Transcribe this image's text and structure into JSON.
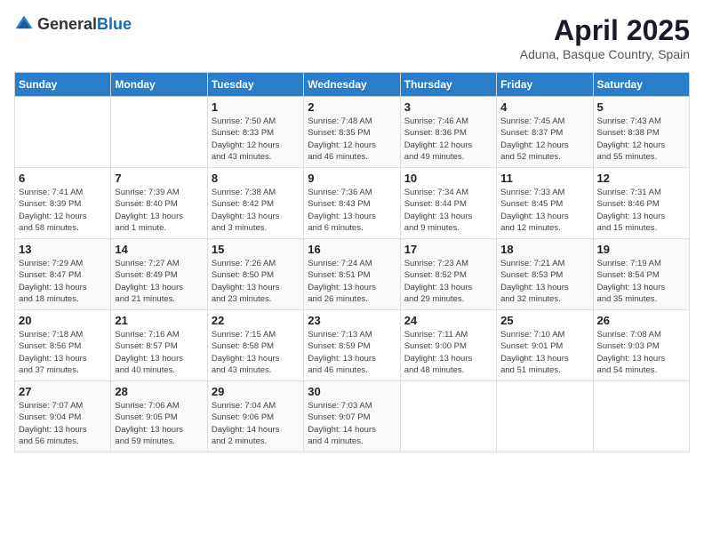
{
  "logo": {
    "general": "General",
    "blue": "Blue"
  },
  "title": "April 2025",
  "subtitle": "Aduna, Basque Country, Spain",
  "days_of_week": [
    "Sunday",
    "Monday",
    "Tuesday",
    "Wednesday",
    "Thursday",
    "Friday",
    "Saturday"
  ],
  "weeks": [
    [
      {
        "day": "",
        "lines": []
      },
      {
        "day": "",
        "lines": []
      },
      {
        "day": "1",
        "lines": [
          "Sunrise: 7:50 AM",
          "Sunset: 8:33 PM",
          "Daylight: 12 hours",
          "and 43 minutes."
        ]
      },
      {
        "day": "2",
        "lines": [
          "Sunrise: 7:48 AM",
          "Sunset: 8:35 PM",
          "Daylight: 12 hours",
          "and 46 minutes."
        ]
      },
      {
        "day": "3",
        "lines": [
          "Sunrise: 7:46 AM",
          "Sunset: 8:36 PM",
          "Daylight: 12 hours",
          "and 49 minutes."
        ]
      },
      {
        "day": "4",
        "lines": [
          "Sunrise: 7:45 AM",
          "Sunset: 8:37 PM",
          "Daylight: 12 hours",
          "and 52 minutes."
        ]
      },
      {
        "day": "5",
        "lines": [
          "Sunrise: 7:43 AM",
          "Sunset: 8:38 PM",
          "Daylight: 12 hours",
          "and 55 minutes."
        ]
      }
    ],
    [
      {
        "day": "6",
        "lines": [
          "Sunrise: 7:41 AM",
          "Sunset: 8:39 PM",
          "Daylight: 12 hours",
          "and 58 minutes."
        ]
      },
      {
        "day": "7",
        "lines": [
          "Sunrise: 7:39 AM",
          "Sunset: 8:40 PM",
          "Daylight: 13 hours",
          "and 1 minute."
        ]
      },
      {
        "day": "8",
        "lines": [
          "Sunrise: 7:38 AM",
          "Sunset: 8:42 PM",
          "Daylight: 13 hours",
          "and 3 minutes."
        ]
      },
      {
        "day": "9",
        "lines": [
          "Sunrise: 7:36 AM",
          "Sunset: 8:43 PM",
          "Daylight: 13 hours",
          "and 6 minutes."
        ]
      },
      {
        "day": "10",
        "lines": [
          "Sunrise: 7:34 AM",
          "Sunset: 8:44 PM",
          "Daylight: 13 hours",
          "and 9 minutes."
        ]
      },
      {
        "day": "11",
        "lines": [
          "Sunrise: 7:33 AM",
          "Sunset: 8:45 PM",
          "Daylight: 13 hours",
          "and 12 minutes."
        ]
      },
      {
        "day": "12",
        "lines": [
          "Sunrise: 7:31 AM",
          "Sunset: 8:46 PM",
          "Daylight: 13 hours",
          "and 15 minutes."
        ]
      }
    ],
    [
      {
        "day": "13",
        "lines": [
          "Sunrise: 7:29 AM",
          "Sunset: 8:47 PM",
          "Daylight: 13 hours",
          "and 18 minutes."
        ]
      },
      {
        "day": "14",
        "lines": [
          "Sunrise: 7:27 AM",
          "Sunset: 8:49 PM",
          "Daylight: 13 hours",
          "and 21 minutes."
        ]
      },
      {
        "day": "15",
        "lines": [
          "Sunrise: 7:26 AM",
          "Sunset: 8:50 PM",
          "Daylight: 13 hours",
          "and 23 minutes."
        ]
      },
      {
        "day": "16",
        "lines": [
          "Sunrise: 7:24 AM",
          "Sunset: 8:51 PM",
          "Daylight: 13 hours",
          "and 26 minutes."
        ]
      },
      {
        "day": "17",
        "lines": [
          "Sunrise: 7:23 AM",
          "Sunset: 8:52 PM",
          "Daylight: 13 hours",
          "and 29 minutes."
        ]
      },
      {
        "day": "18",
        "lines": [
          "Sunrise: 7:21 AM",
          "Sunset: 8:53 PM",
          "Daylight: 13 hours",
          "and 32 minutes."
        ]
      },
      {
        "day": "19",
        "lines": [
          "Sunrise: 7:19 AM",
          "Sunset: 8:54 PM",
          "Daylight: 13 hours",
          "and 35 minutes."
        ]
      }
    ],
    [
      {
        "day": "20",
        "lines": [
          "Sunrise: 7:18 AM",
          "Sunset: 8:56 PM",
          "Daylight: 13 hours",
          "and 37 minutes."
        ]
      },
      {
        "day": "21",
        "lines": [
          "Sunrise: 7:16 AM",
          "Sunset: 8:57 PM",
          "Daylight: 13 hours",
          "and 40 minutes."
        ]
      },
      {
        "day": "22",
        "lines": [
          "Sunrise: 7:15 AM",
          "Sunset: 8:58 PM",
          "Daylight: 13 hours",
          "and 43 minutes."
        ]
      },
      {
        "day": "23",
        "lines": [
          "Sunrise: 7:13 AM",
          "Sunset: 8:59 PM",
          "Daylight: 13 hours",
          "and 46 minutes."
        ]
      },
      {
        "day": "24",
        "lines": [
          "Sunrise: 7:11 AM",
          "Sunset: 9:00 PM",
          "Daylight: 13 hours",
          "and 48 minutes."
        ]
      },
      {
        "day": "25",
        "lines": [
          "Sunrise: 7:10 AM",
          "Sunset: 9:01 PM",
          "Daylight: 13 hours",
          "and 51 minutes."
        ]
      },
      {
        "day": "26",
        "lines": [
          "Sunrise: 7:08 AM",
          "Sunset: 9:03 PM",
          "Daylight: 13 hours",
          "and 54 minutes."
        ]
      }
    ],
    [
      {
        "day": "27",
        "lines": [
          "Sunrise: 7:07 AM",
          "Sunset: 9:04 PM",
          "Daylight: 13 hours",
          "and 56 minutes."
        ]
      },
      {
        "day": "28",
        "lines": [
          "Sunrise: 7:06 AM",
          "Sunset: 9:05 PM",
          "Daylight: 13 hours",
          "and 59 minutes."
        ]
      },
      {
        "day": "29",
        "lines": [
          "Sunrise: 7:04 AM",
          "Sunset: 9:06 PM",
          "Daylight: 14 hours",
          "and 2 minutes."
        ]
      },
      {
        "day": "30",
        "lines": [
          "Sunrise: 7:03 AM",
          "Sunset: 9:07 PM",
          "Daylight: 14 hours",
          "and 4 minutes."
        ]
      },
      {
        "day": "",
        "lines": []
      },
      {
        "day": "",
        "lines": []
      },
      {
        "day": "",
        "lines": []
      }
    ]
  ]
}
